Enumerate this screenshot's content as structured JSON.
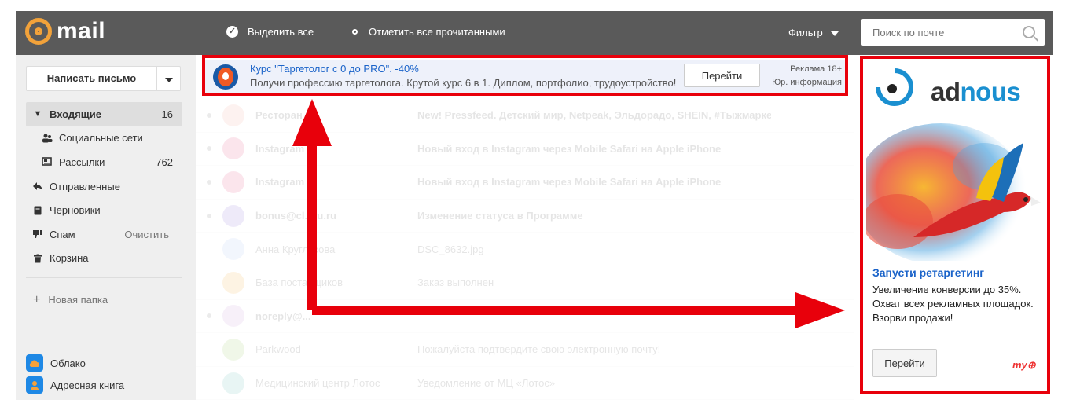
{
  "header": {
    "logo_text": "mail",
    "select_all": "Выделить все",
    "mark_all_read": "Отметить все прочитанными",
    "filter": "Фильтр",
    "search_placeholder": "Поиск по почте"
  },
  "sidebar": {
    "compose": "Написать письмо",
    "items": [
      {
        "label": "Входящие",
        "count": "16",
        "icon": "triangle-down-icon"
      },
      {
        "label": "Социальные сети",
        "count": "",
        "icon": "people-icon"
      },
      {
        "label": "Рассылки",
        "count": "762",
        "icon": "newsletter-icon"
      },
      {
        "label": "Отправленные",
        "count": "",
        "icon": "sent-icon"
      },
      {
        "label": "Черновики",
        "count": "",
        "icon": "draft-icon"
      },
      {
        "label": "Спам",
        "action": "Очистить",
        "icon": "spam-icon"
      },
      {
        "label": "Корзина",
        "count": "",
        "icon": "trash-icon"
      }
    ],
    "new_folder": "Новая папка",
    "apps": [
      {
        "label": "Облако",
        "icon": "cloud-icon"
      },
      {
        "label": "Адресная книга",
        "icon": "contacts-icon"
      }
    ]
  },
  "top_ad": {
    "title": "Курс \"Таргетолог с 0 до PRO\". -40%",
    "text": "Получи профессию таргетолога. Крутой курс 6 в 1. Диплом, портфолио, трудоустройство!",
    "button": "Перейти",
    "label1": "Реклама 18+",
    "label2": "Юр. информация"
  },
  "emails": [
    {
      "from": "Ресторан",
      "subject": "New! Pressfeed. Детский мир, Netpeak, Эльдорадо, SHEIN, #Тыжмаркет",
      "date": ""
    },
    {
      "from": "Instagram",
      "subject": "Новый вход в Instagram через Mobile Safari на Apple iPhone",
      "date": ""
    },
    {
      "from": "Instagram",
      "subject": "Новый вход в Instagram через Mobile Safari на Apple iPhone",
      "date": ""
    },
    {
      "from": "bonus@cl...ru.ru",
      "subject": "Изменение статуса в Программе",
      "date": ""
    },
    {
      "from": "Анна Кругликова",
      "subject": "DSC_8632.jpg",
      "date": ""
    },
    {
      "from": "База поставщиков",
      "subject": "Заказ выполнен",
      "date": ""
    },
    {
      "from": "noreply@...",
      "subject": "",
      "date": ""
    },
    {
      "from": "Parkwood",
      "subject": "Пожалуйста подтвердите свою электронную почту!",
      "date": ""
    },
    {
      "from": "Медицинский центр Лотос",
      "subject": "Уведомление от МЦ «Лотос»",
      "date": ""
    }
  ],
  "right_ad": {
    "brand_prefix": "ad",
    "brand_suffix": "nous",
    "title": "Запусти ретаргетинг",
    "text": "Увеличение конверсии до 35%. Охват всех рекламных площадок. Взорви продажи!",
    "button": "Перейти",
    "mark": "my"
  },
  "colors": {
    "header_bg": "#5a5a5a",
    "logo_orange": "#f2a23a",
    "link_blue": "#1a63c9",
    "highlight_red": "#e8000b"
  }
}
